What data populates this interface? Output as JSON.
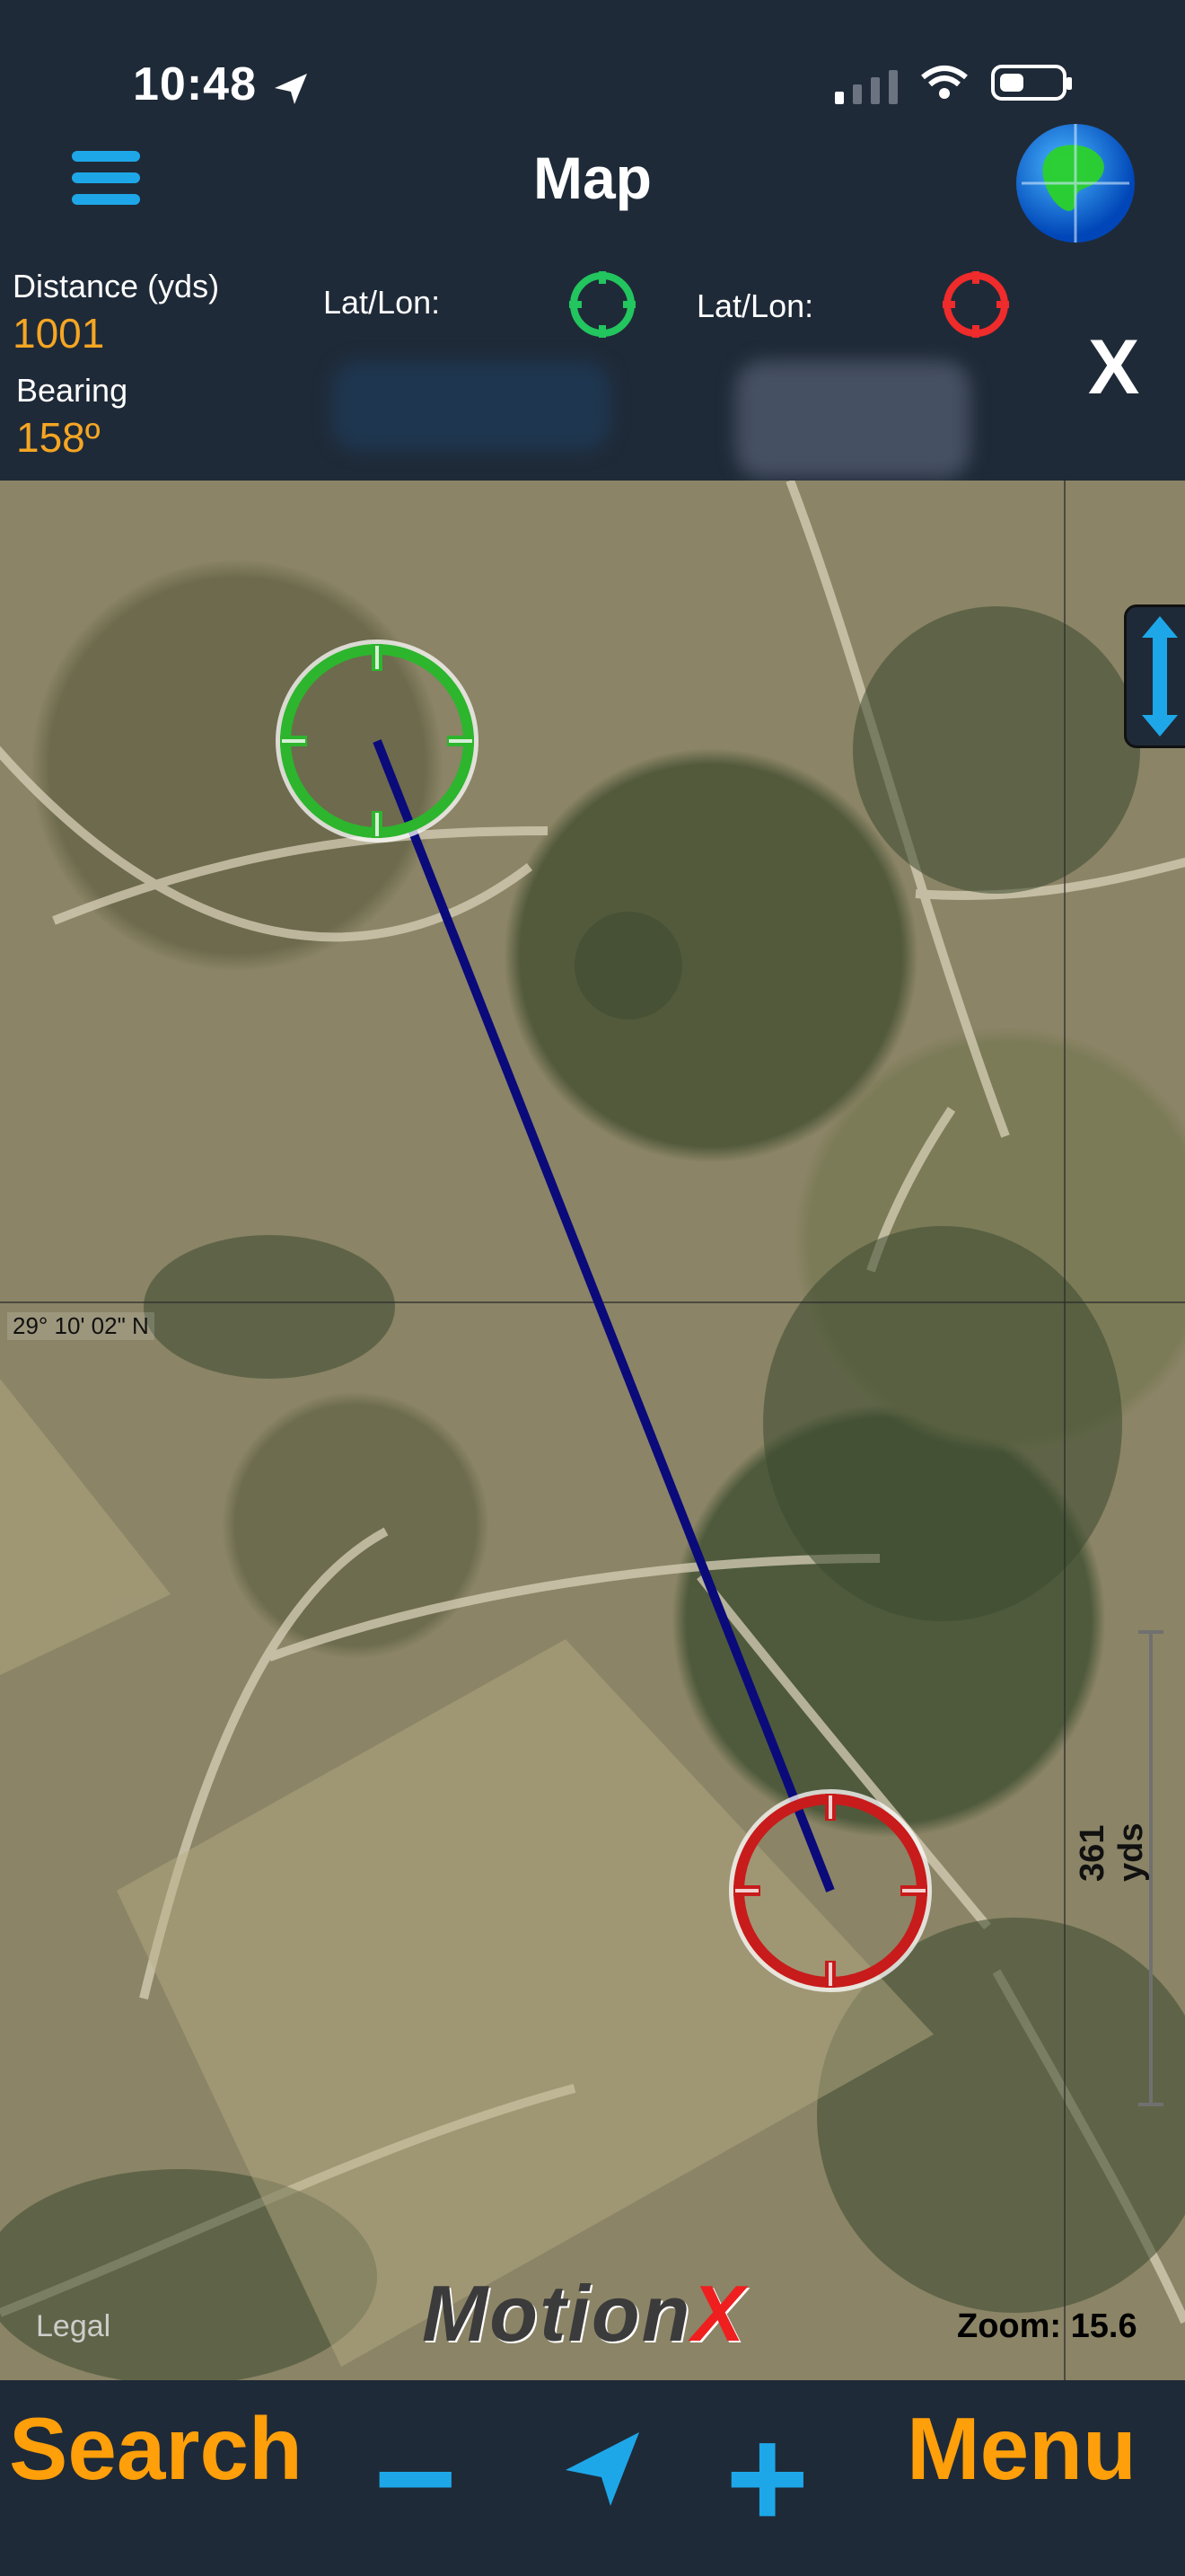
{
  "status": {
    "time": "10:48"
  },
  "header": {
    "title": "Map",
    "distance_label": "Distance (yds)",
    "distance_value": "1001",
    "bearing_label": "Bearing",
    "bearing_value": "158º",
    "latlon_label_1": "Lat/Lon:",
    "latlon_label_2": "Lat/Lon:",
    "close_label": "X"
  },
  "map": {
    "lat_label": "29° 10' 02\" N",
    "scale_label": "361 yds",
    "legal_label": "Legal",
    "zoom_label": "Zoom: 15.6",
    "brand": {
      "part1": "Motion",
      "part2": "X"
    }
  },
  "bottom_bar": {
    "search_label": "Search",
    "minus_label": "−",
    "plus_label": "+",
    "menu_label": "Menu"
  },
  "icons": {
    "menu_icon": "hamburger-menu-icon",
    "globe_icon": "globe-icon",
    "green_target_icon": "green-crosshair-icon",
    "red_target_icon": "red-crosshair-icon",
    "location_icon": "location-arrow-icon",
    "vertical_toggle_icon": "vertical-arrows-icon"
  },
  "colors": {
    "accent_orange": "#f5a623",
    "accent_blue": "#1ea7e8",
    "green_marker": "#2db52d",
    "red_marker": "#c81b1b",
    "line_blue": "#0b0a7a"
  }
}
